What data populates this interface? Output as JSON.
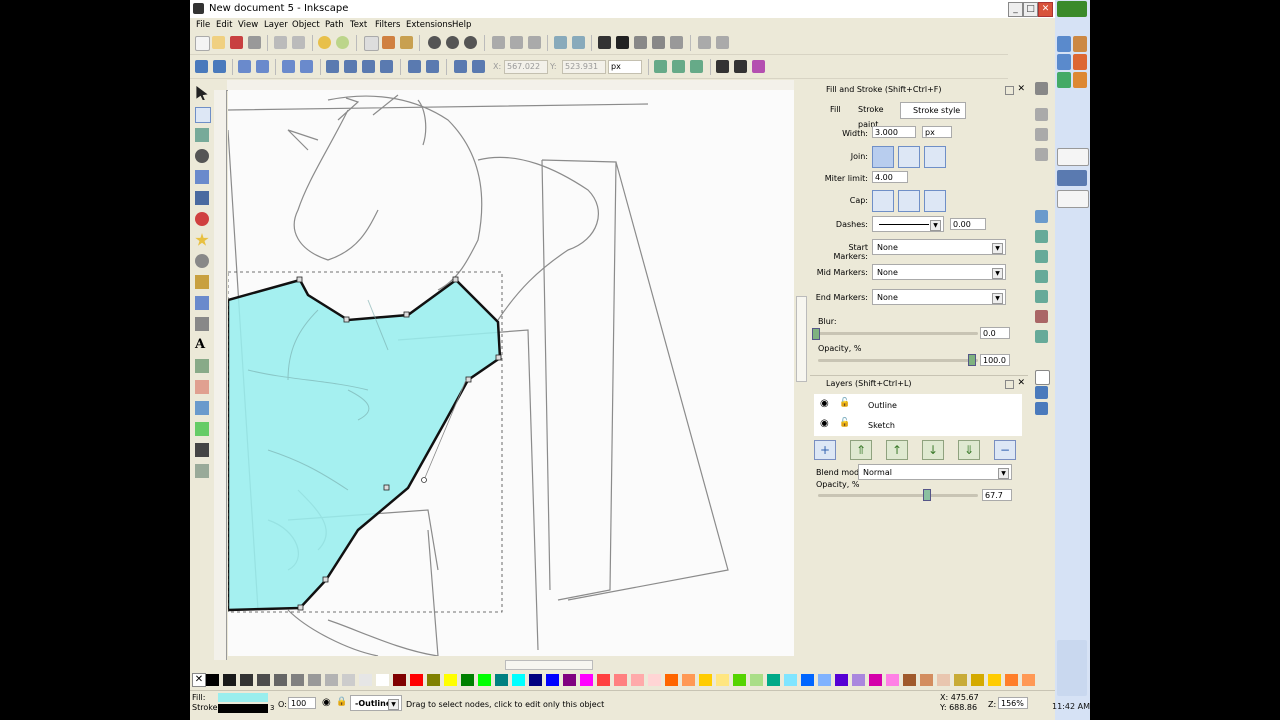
{
  "window": {
    "title": "New document 5 - Inkscape",
    "min": "_",
    "max": "□",
    "close": "✕"
  },
  "menu": [
    "File",
    "Edit",
    "View",
    "Layer",
    "Object",
    "Path",
    "Text",
    "Filters",
    "Extensions",
    "Help"
  ],
  "node_toolbar": {
    "x_label": "X:",
    "x_value": "567.022",
    "y_label": "Y:",
    "y_value": "523.931",
    "unit": "px"
  },
  "fill_stroke": {
    "title": "Fill and Stroke (Shift+Ctrl+F)",
    "tabs": [
      "Fill",
      "Stroke paint",
      "Stroke style"
    ],
    "active_tab": "Stroke style",
    "width_label": "Width:",
    "width_value": "3.000",
    "width_unit": "px",
    "join_label": "Join:",
    "miter_label": "Miter limit:",
    "miter_value": "4.00",
    "cap_label": "Cap:",
    "dashes_label": "Dashes:",
    "dashes_value": "0.00",
    "start_markers_label": "Start Markers:",
    "start_markers_value": "None",
    "mid_markers_label": "Mid Markers:",
    "mid_markers_value": "None",
    "end_markers_label": "End Markers:",
    "end_markers_value": "None",
    "blur_label": "Blur:",
    "blur_value": "0.0",
    "opacity_label": "Opacity, %",
    "opacity_value": "100.0"
  },
  "layers": {
    "title": "Layers (Shift+Ctrl+L)",
    "items": [
      {
        "name": "Outline"
      },
      {
        "name": "Sketch"
      }
    ],
    "blend_label": "Blend mode:",
    "blend_value": "Normal",
    "opacity_label": "Opacity, %",
    "opacity_value": "67.7",
    "opacity_fraction": 0.677
  },
  "status": {
    "fill_label": "Fill:",
    "stroke_label": "Stroke:",
    "stroke_width": "3",
    "o_label": "O:",
    "o_value": "100",
    "layer_value": "-Outline",
    "message": "Drag to select nodes, click to edit only this object",
    "x_coord": "X: 475.67",
    "y_coord": "Y: 688.86",
    "zoom_label": "Z:",
    "zoom_value": "156%"
  },
  "colors": {
    "fill": "#99eeee",
    "stroke": "#000000",
    "accent": "#4a7abc"
  },
  "clock": "11:42 AM"
}
